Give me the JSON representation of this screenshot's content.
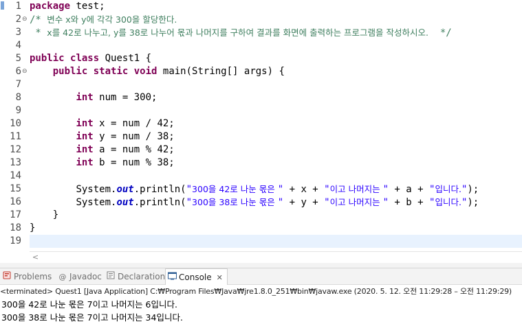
{
  "editor": {
    "line_numbers": [
      "1",
      "2",
      "3",
      "4",
      "5",
      "6",
      "7",
      "8",
      "9",
      "10",
      "11",
      "12",
      "13",
      "14",
      "15",
      "16",
      "17",
      "18",
      "19"
    ],
    "fold_markers": {
      "2": "⊖",
      "6": "⊖"
    },
    "code": {
      "l1_kw": "package",
      "l1_rest": " test;",
      "l2_comment_a": "/* ",
      "l2_comment_ko": "변수 x와 y에 각각 300을 할당한다.",
      "l3_comment_a": " * ",
      "l3_comment_ko": "x를 42로 나누고, y를 38로 나누어 몫과 나머지를 구하여 결과를 화면에 출력하는 프로그램을 작성하시오.",
      "l3_comment_end": "  */",
      "l5_kw1": "public",
      "l5_kw2": "class",
      "l5_rest": " Quest1 {",
      "l6_kw1": "public",
      "l6_kw2": "static",
      "l6_kw3": "void",
      "l6_rest": " main(String[] args) {",
      "l8_kw": "int",
      "l8_rest": " num = 300;",
      "l10_kw": "int",
      "l10_rest": " x = num / 42;",
      "l11_kw": "int",
      "l11_rest": " y = num / 38;",
      "l12_kw": "int",
      "l12_rest": " a = num % 42;",
      "l13_kw": "int",
      "l13_rest": " b = num % 38;",
      "l15_pre": "System.",
      "l15_field": "out",
      "l15_call": ".println(",
      "l15_s1_q": "\"",
      "l15_s1_ko": "300을 42로 나눈 몫은 ",
      "l15_s1_end": "\"",
      "l15_op1": " + x + ",
      "l15_s2_q": "\"",
      "l15_s2_ko": "이고 나머지는 ",
      "l15_s2_end": "\"",
      "l15_op2": " + a + ",
      "l15_s3_q": "\"",
      "l15_s3_ko": "입니다.",
      "l15_s3_end": "\"",
      "l15_close": ");",
      "l16_pre": "System.",
      "l16_field": "out",
      "l16_call": ".println(",
      "l16_s1_q": "\"",
      "l16_s1_ko": "300을 38로 나눈 몫은 ",
      "l16_s1_end": "\"",
      "l16_op1": " + y + ",
      "l16_s2_q": "\"",
      "l16_s2_ko": "이고 나머지는 ",
      "l16_s2_end": "\"",
      "l16_op2": " + b + ",
      "l16_s3_q": "\"",
      "l16_s3_ko": "입니다.",
      "l16_s3_end": "\"",
      "l16_close": ");",
      "l17": "    }",
      "l18": "}"
    }
  },
  "scrollbar": {
    "left_arrow": "<"
  },
  "views": {
    "tabs": [
      {
        "label": "Problems",
        "icon": "problems-icon"
      },
      {
        "label": "Javadoc",
        "icon": "javadoc-icon"
      },
      {
        "label": "Declaration",
        "icon": "declaration-icon"
      },
      {
        "label": "Console",
        "icon": "console-icon",
        "active": true
      }
    ],
    "close_symbol": "✕"
  },
  "console": {
    "status": "<terminated> Quest1 [Java Application] C:₩Program Files₩Java₩jre1.8.0_251₩bin₩javaw.exe  (2020. 5. 12. 오전 11:29:28 – 오전 11:29:29)",
    "output": [
      "300을 42로 나눈 몫은 7이고 나머지는 6입니다.",
      "300을 38로 나눈 몫은 7이고 나머지는 34입니다."
    ]
  },
  "colors": {
    "keyword": "#7f0055",
    "comment": "#3f7f5f",
    "string": "#2a00ff",
    "field": "#0000c0",
    "current_line": "#e8f2fe"
  }
}
